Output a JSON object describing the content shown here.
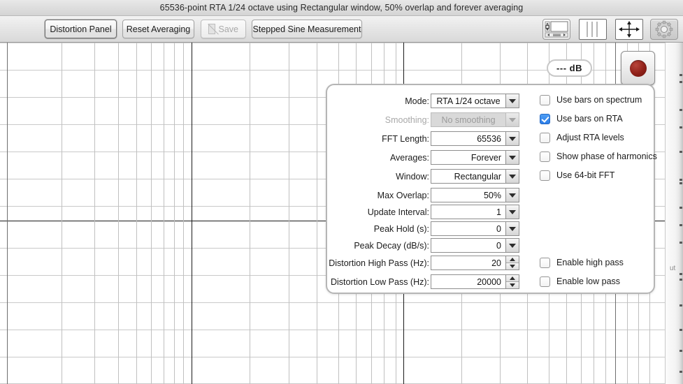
{
  "window": {
    "title": "65536-point RTA 1/24 octave using Rectangular window, 50% overlap and forever averaging"
  },
  "toolbar": {
    "buttons": [
      {
        "label": "Distortion Panel",
        "state": "primary"
      },
      {
        "label": "Reset Averaging",
        "state": "normal"
      },
      {
        "label": "Save",
        "state": "disabled"
      },
      {
        "label": "Stepped Sine Measurement",
        "state": "normal"
      }
    ],
    "icons": [
      {
        "name": "scroll-controls-icon",
        "title": "Scroll controls"
      },
      {
        "name": "columns-icon",
        "title": "Columns"
      },
      {
        "name": "fit-width-icon",
        "title": "Fit width"
      },
      {
        "name": "gear-icon",
        "title": "Settings",
        "active": true
      }
    ]
  },
  "readout": {
    "db_value": "--- dB",
    "record_button": "record-button"
  },
  "settings_panel": {
    "rows": [
      {
        "label": "Mode:",
        "value": "RTA 1/24 octave",
        "control": "dropdown",
        "align": "center",
        "disabled": false
      },
      {
        "label": "Smoothing:",
        "value": "No  smoothing",
        "control": "dropdown",
        "align": "center",
        "disabled": true
      },
      {
        "label": "FFT Length:",
        "value": "65536",
        "control": "dropdown",
        "align": "right",
        "disabled": false
      },
      {
        "label": "Averages:",
        "value": "Forever",
        "control": "dropdown",
        "align": "right",
        "disabled": false
      },
      {
        "label": "Window:",
        "value": "Rectangular",
        "control": "dropdown",
        "align": "right",
        "disabled": false
      },
      {
        "label": "Max Overlap:",
        "value": "50%",
        "control": "dropdown",
        "align": "right",
        "disabled": false
      },
      {
        "label": "Update Interval:",
        "value": "1",
        "control": "dropdown",
        "align": "right",
        "disabled": false
      },
      {
        "label": "Peak Hold (s):",
        "value": "0",
        "control": "dropdown",
        "align": "right",
        "disabled": false
      },
      {
        "label": "Peak Decay (dB/s):",
        "value": "0",
        "control": "dropdown",
        "align": "right",
        "disabled": false
      },
      {
        "label": "Distortion High Pass (Hz):",
        "value": "20",
        "control": "spinner",
        "align": "right",
        "disabled": false
      },
      {
        "label": "Distortion Low Pass (Hz):",
        "value": "20000",
        "control": "spinner",
        "align": "right",
        "disabled": false
      }
    ],
    "checkboxes": [
      {
        "label": "Use bars on spectrum",
        "checked": false
      },
      {
        "label": "Use bars on RTA",
        "checked": true
      },
      {
        "label": "Adjust RTA levels",
        "checked": false
      },
      {
        "label": "Show phase of harmonics",
        "checked": false
      },
      {
        "label": "Use 64-bit FFT",
        "checked": false
      },
      {
        "label": "Enable high pass",
        "checked": false
      },
      {
        "label": "Enable low pass",
        "checked": false
      }
    ]
  },
  "colors": {
    "accent_checkbox": "#2b7de8",
    "record_red": "#8f2018",
    "grid_line": "#c7c7c7",
    "grid_major": "#8a8a8a",
    "axis_line": "#1a1a1a",
    "toolbar_bg": "#e4e4e4",
    "title_bg": "#dedede"
  },
  "chart_data": {
    "type": "line",
    "title": "",
    "xlabel": "",
    "ylabel": "",
    "series": [],
    "grid": true,
    "x_scale": "log",
    "x_major_ticks": [
      10,
      100,
      1000,
      10000
    ],
    "x_minor_ticks": [
      20,
      30,
      40,
      50,
      60,
      70,
      80,
      90,
      200,
      300,
      400,
      500,
      600,
      700,
      800,
      900,
      2000,
      3000,
      4000,
      5000,
      6000,
      7000,
      8000,
      9000,
      20000
    ],
    "y_gridlines": 9,
    "zero_axis_y": 316,
    "note": "Empty RTA plot: log-frequency grid with no traces drawn"
  },
  "right_strip": {
    "partial_text": "ut"
  }
}
